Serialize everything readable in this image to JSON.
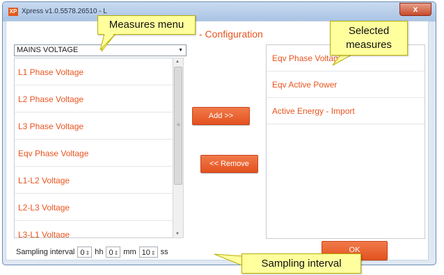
{
  "window": {
    "title": "Xpress v1.0.5578.26510 - L",
    "app_icon": "XP",
    "close_glyph": "x"
  },
  "header": {
    "config_label": "- Configuration"
  },
  "measures_combo": {
    "selected": "MAINS VOLTAGE",
    "arrow_icon": "chevron-down-icon"
  },
  "measures_list": {
    "items": [
      "L1 Phase Voltage",
      "L2 Phase Voltage",
      "L3 Phase Voltage",
      "Eqv Phase Voltage",
      "L1-L2 Voltage",
      "L2-L3 Voltage",
      "L3-L1 Voltage"
    ]
  },
  "buttons": {
    "add_label": "Add >>",
    "remove_label": "<< Remove",
    "ok_label": "OK"
  },
  "selected_list": {
    "items": [
      "Eqv Phase Voltage",
      "Eqv Active Power",
      "Active Energy - Import"
    ]
  },
  "sampling": {
    "label": "Sampling interval",
    "hours_value": "0",
    "hours_unit": "hh",
    "minutes_value": "0",
    "minutes_unit": "mm",
    "seconds_value": "10",
    "seconds_unit": "ss"
  },
  "callouts": {
    "measures_menu": "Measures menu",
    "selected_measures": "Selected measures",
    "sampling_interval": "Sampling interval"
  },
  "colors": {
    "accent": "#e8541f",
    "callout_fill": "#ffff9e"
  }
}
